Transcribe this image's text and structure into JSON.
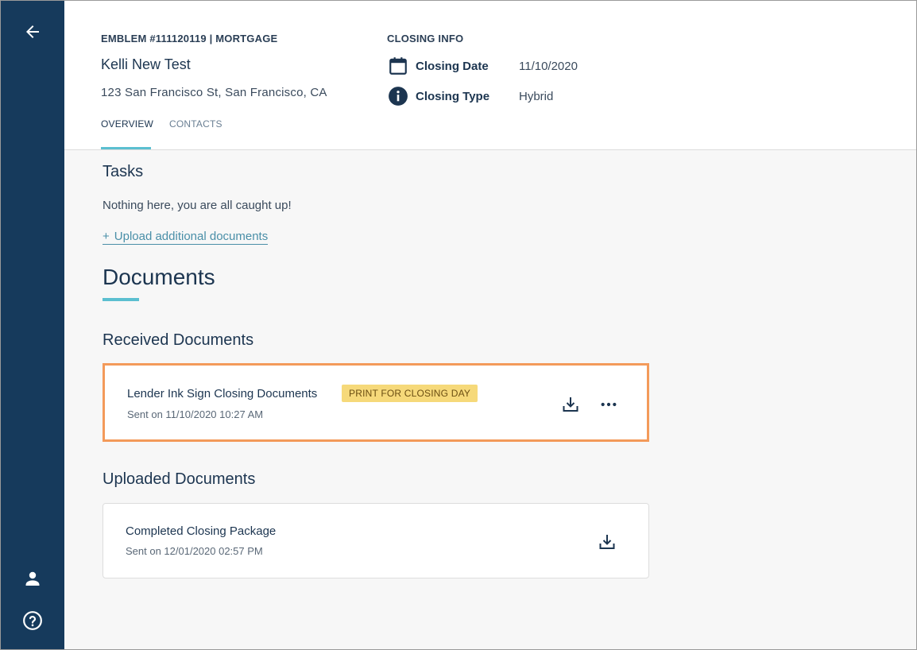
{
  "header": {
    "loan_line": "EMBLEM #111120119 | MORTGAGE",
    "borrower_name": "Kelli New Test",
    "address": "123 San Francisco St, San Francisco, CA",
    "tabs": [
      {
        "label": "OVERVIEW",
        "active": true
      },
      {
        "label": "CONTACTS",
        "active": false
      }
    ]
  },
  "closing_info": {
    "title": "CLOSING INFO",
    "date_label": "Closing Date",
    "date_value": "11/10/2020",
    "type_label": "Closing Type",
    "type_value": "Hybrid"
  },
  "tasks": {
    "title": "Tasks",
    "empty_message": "Nothing here, you are all caught up!",
    "upload_link_label": "Upload additional documents"
  },
  "documents": {
    "title": "Documents",
    "received": {
      "title": "Received Documents",
      "items": [
        {
          "name": "Lender Ink Sign Closing Documents",
          "badge": "PRINT FOR CLOSING DAY",
          "sent": "Sent on 11/10/2020 10:27 AM"
        }
      ]
    },
    "uploaded": {
      "title": "Uploaded Documents",
      "items": [
        {
          "name": "Completed Closing Package",
          "sent": "Sent on 12/01/2020 02:57 PM"
        }
      ]
    }
  },
  "sidebar": {
    "icons": [
      "arrow-left-icon",
      "user-icon",
      "help-icon"
    ]
  },
  "colors": {
    "sidebar": "#163a5c",
    "accent": "#5bbfd0",
    "highlight_border": "#f39a5a",
    "badge_bg": "#f6d97a",
    "link": "#4a8fa8"
  }
}
